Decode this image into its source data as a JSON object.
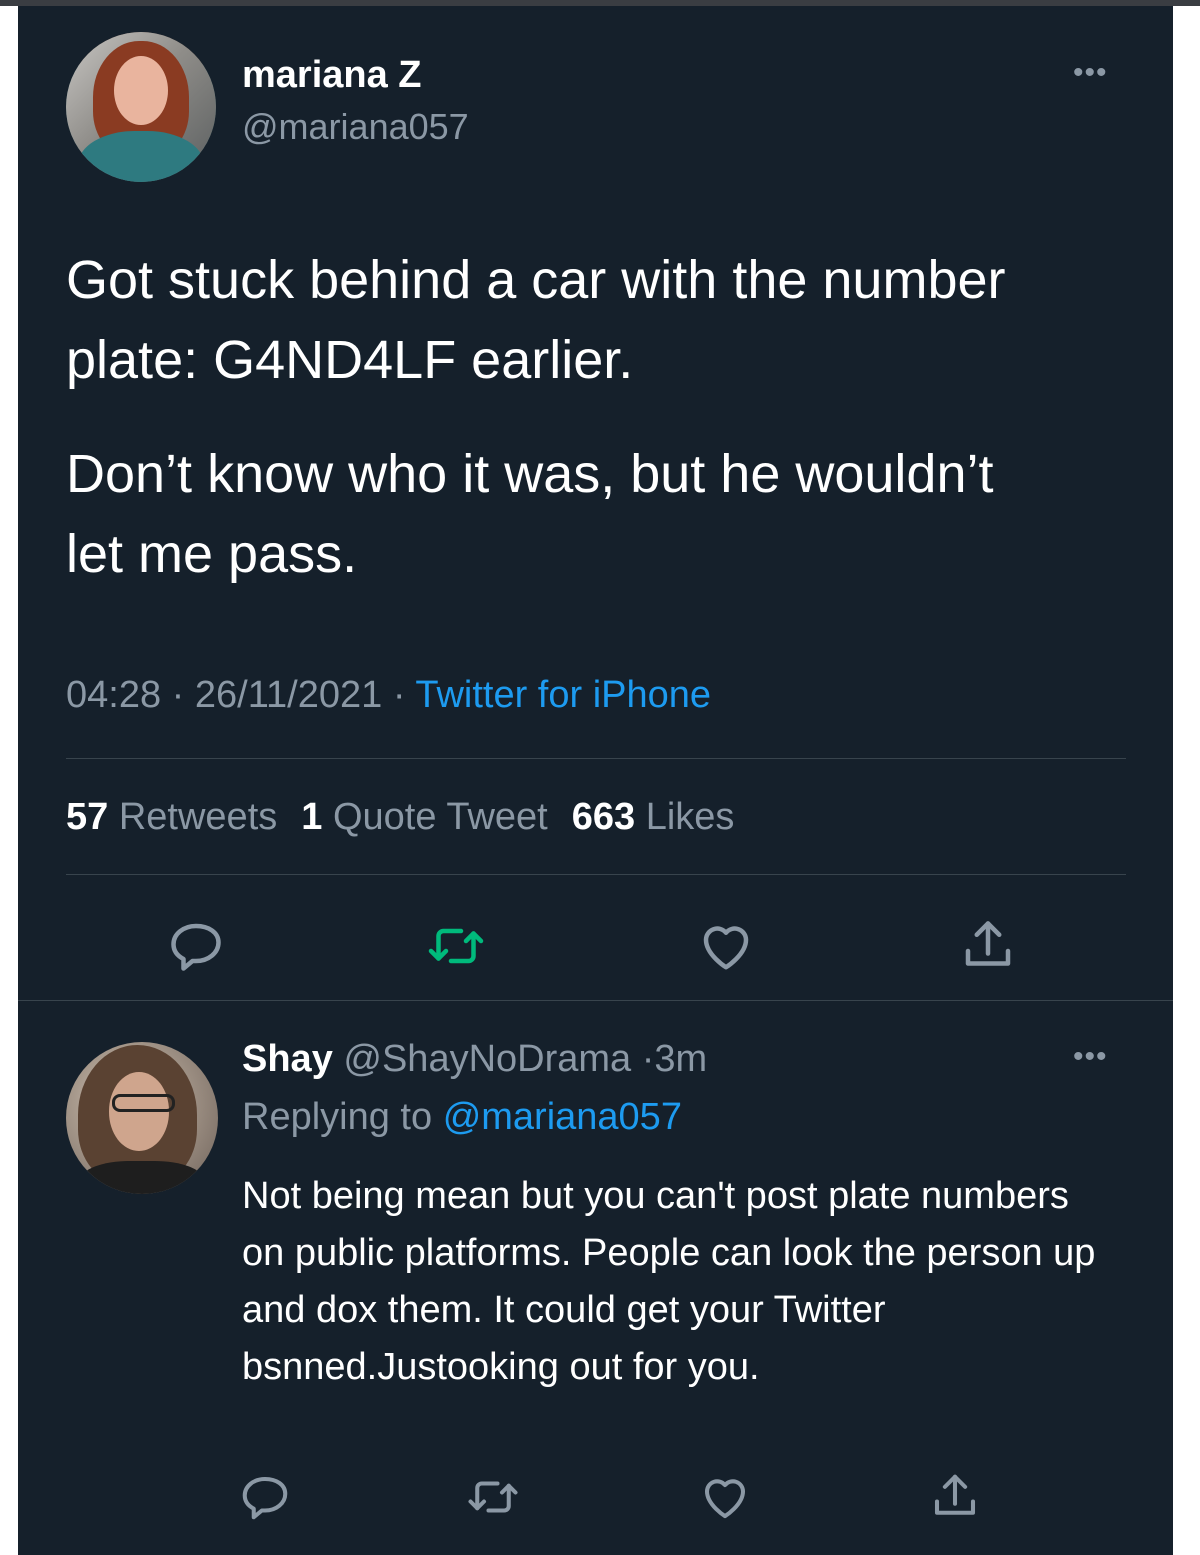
{
  "tweet": {
    "author_name": "mariana Z",
    "author_handle": "@mariana057",
    "more_label": "•••",
    "text_p1": "Got stuck behind a car with the number plate: G4ND4LF earlier.",
    "text_p2": "Don’t know who it was, but he wouldn’t let me pass.",
    "time": "04:28",
    "date": "26/11/2021",
    "separator": "·",
    "source": "Twitter for iPhone",
    "retweets_count": "57",
    "retweets_label": "Retweets",
    "quotes_count": "1",
    "quotes_label": "Quote Tweet",
    "likes_count": "663",
    "likes_label": "Likes",
    "actions": [
      "reply-icon",
      "retweet-icon",
      "like-icon",
      "share-icon"
    ]
  },
  "reply": {
    "author_name": "Shay",
    "author_handle": "@ShayNoDrama",
    "age": "3m",
    "separator": "·",
    "more_label": "•••",
    "replying_prefix": "Replying to",
    "replying_to": "@mariana057",
    "text": "Not being mean but you can't post plate numbers on public platforms. People can look the person up and dox them. It could get your Twitter bsnned.Justooking out for you.",
    "actions": [
      "reply-icon",
      "retweet-icon",
      "like-icon",
      "share-icon"
    ]
  },
  "colors": {
    "background": "#15202b",
    "muted_text": "#8b98a5",
    "link_blue": "#1d9bf0",
    "retweet_green": "#00ba7c",
    "divider": "#38444d"
  }
}
